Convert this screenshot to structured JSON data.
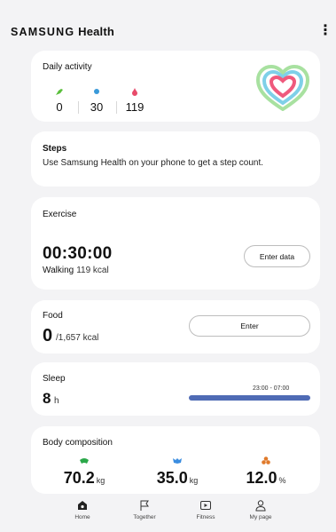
{
  "app": {
    "brand_samsung": "SAMSUNG",
    "brand_health": "Health",
    "menu_icon": "more-vert-icon"
  },
  "daily_activity": {
    "title": "Daily activity",
    "stats": [
      {
        "icon": "steps-shoe-icon",
        "color": "#5bbf3c",
        "value": "0"
      },
      {
        "icon": "active-time-dot-icon",
        "color": "#3a9ad9",
        "value": "30"
      },
      {
        "icon": "calorie-flame-icon",
        "color": "#e84b6a",
        "value": "119"
      }
    ],
    "ring_colors": [
      "#ef5a7d",
      "#7fd0e8",
      "#a8e1a0"
    ]
  },
  "steps": {
    "title": "Steps",
    "description": "Use Samsung Health on your phone to get a step count."
  },
  "exercise": {
    "title": "Exercise",
    "time": "00:30:00",
    "activity": "Walking",
    "kcal": "119 kcal",
    "button": "Enter data"
  },
  "food": {
    "title": "Food",
    "value": "0",
    "unit": "/1,657 kcal",
    "button": "Enter"
  },
  "sleep": {
    "title": "Sleep",
    "value": "8",
    "unit": "h",
    "range": "23:00 - 07:00",
    "bar_color": "#4f6bb5"
  },
  "body_composition": {
    "title": "Body composition",
    "items": [
      {
        "icon": "weight-icon",
        "color": "#2ba84a",
        "value": "70.2",
        "unit": "kg"
      },
      {
        "icon": "muscle-icon",
        "color": "#3b8de0",
        "value": "35.0",
        "unit": "kg"
      },
      {
        "icon": "body-fat-icon",
        "color": "#e07a2b",
        "value": "12.0",
        "unit": "%"
      }
    ]
  },
  "nav": {
    "items": [
      {
        "label": "Home",
        "icon": "home-icon",
        "active": true
      },
      {
        "label": "Together",
        "icon": "flag-icon",
        "active": false
      },
      {
        "label": "Fitness",
        "icon": "fitness-play-icon",
        "active": false
      },
      {
        "label": "My page",
        "icon": "person-icon",
        "active": false
      }
    ]
  }
}
